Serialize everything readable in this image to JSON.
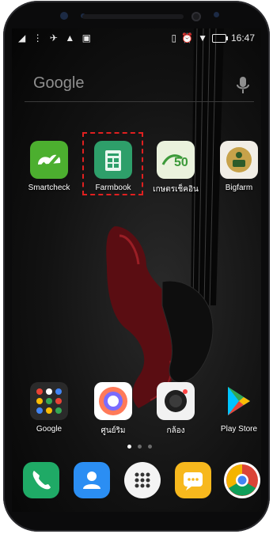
{
  "status_bar": {
    "time": "16:47",
    "left_icons": [
      "signal-icon",
      "more-vert-icon",
      "no-notification-icon",
      "warning-icon",
      "image-icon"
    ],
    "right_icons": [
      "vibrate-icon",
      "alarm-icon",
      "wifi-icon",
      "battery-icon"
    ]
  },
  "search_bar": {
    "logo": "Google",
    "icon": "mic-icon"
  },
  "home_apps": [
    {
      "label": "Smartcheck",
      "color": "#4caf2f"
    },
    {
      "label": "Farmbook",
      "color": "#2e9f6a",
      "highlighted": true
    },
    {
      "label": "เกษตรเช็คอิน",
      "color": "#eaf2dd"
    },
    {
      "label": "Bigfarm",
      "color": "#f1eee6"
    }
  ],
  "folder_apps": [
    {
      "label": "Google",
      "color": "#2a2a2a"
    },
    {
      "label": "ศูนย์ริม",
      "color": "#ffffff"
    },
    {
      "label": "กล้อง",
      "color": "#f2f2f2"
    },
    {
      "label": "Play Store",
      "color": "#000000"
    }
  ],
  "page_indicator": {
    "pages": 3,
    "current": 1
  },
  "dock": [
    {
      "icon": "phone-icon",
      "color": "#1faa66"
    },
    {
      "icon": "contacts-icon",
      "color": "#2b8ef3"
    },
    {
      "icon": "app-drawer-icon",
      "color": "#f4f4f4"
    },
    {
      "icon": "messages-icon",
      "color": "#f7b81d"
    },
    {
      "icon": "chrome-icon",
      "color": "#ffffff"
    }
  ]
}
